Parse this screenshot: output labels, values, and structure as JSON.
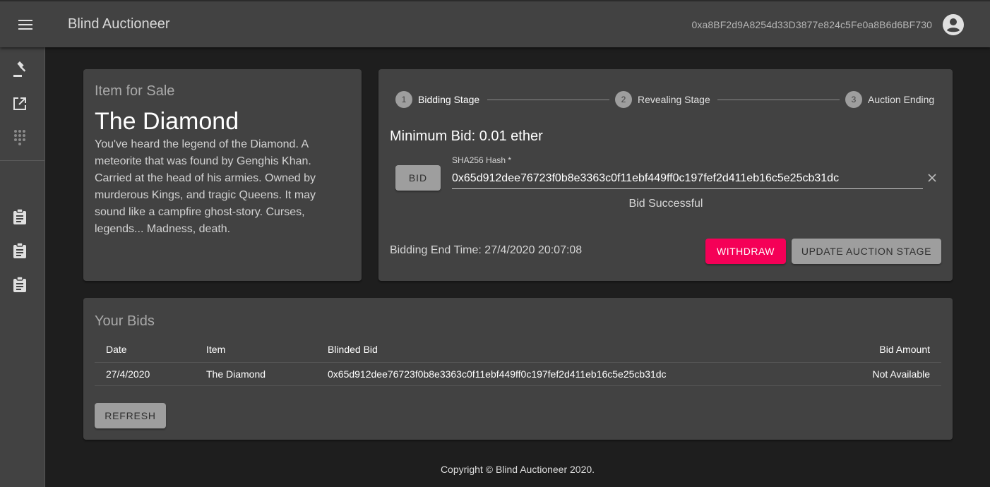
{
  "app": {
    "title": "Blind Auctioneer",
    "account": "0xa8BF2d9A8254d33D3877e824c5Fe0a8B6d6BF730"
  },
  "icons": {
    "menu": "menu-icon",
    "avatar": "account-circle-icon",
    "drawer": [
      "gavel-icon",
      "open-in-new-icon",
      "dialpad-icon",
      "assignment-icon",
      "assignment-icon",
      "assignment-icon"
    ],
    "clear": "close-icon"
  },
  "item": {
    "subtitle": "Item for Sale",
    "name": "The Diamond",
    "description": "You've heard the legend of the Diamond. A meteorite that was found by Genghis Khan. Carried at the head of his armies. Owned by murderous Kings, and tragic Queens. It may sound like a campfire ghost-story. Curses, legends... Madness, death."
  },
  "auction": {
    "steps": [
      {
        "number": "1",
        "label": "Bidding Stage"
      },
      {
        "number": "2",
        "label": "Revealing Stage"
      },
      {
        "number": "3",
        "label": "Auction Ending"
      }
    ],
    "active_step": 1,
    "minimum_bid": "Minimum Bid: 0.01 ether",
    "bid_button": "BID",
    "hash_label": "SHA256 Hash *",
    "hash_value": "0x65d912dee76723f0b8e3363c0f11ebf449ff0c197fef2d411eb16c5e25cb31dc",
    "status": "Bid Successful",
    "end_time": "Bidding End Time: 27/4/2020 20:07:08",
    "withdraw_button": "WITHDRAW",
    "update_button": "UPDATE AUCTION STAGE"
  },
  "bids": {
    "title": "Your Bids",
    "columns": [
      "Date",
      "Item",
      "Blinded Bid",
      "Bid Amount"
    ],
    "rows": [
      [
        "27/4/2020",
        "The Diamond",
        "0x65d912dee76723f0b8e3363c0f11ebf449ff0c197fef2d411eb16c5e25cb31dc",
        "Not Available"
      ]
    ],
    "refresh_button": "REFRESH"
  },
  "footer": "Copyright © Blind Auctioneer 2020.",
  "colors": {
    "accent": "#f50057",
    "surface": "#424242",
    "background": "#1e1e1e",
    "button": "#9e9e9e"
  }
}
